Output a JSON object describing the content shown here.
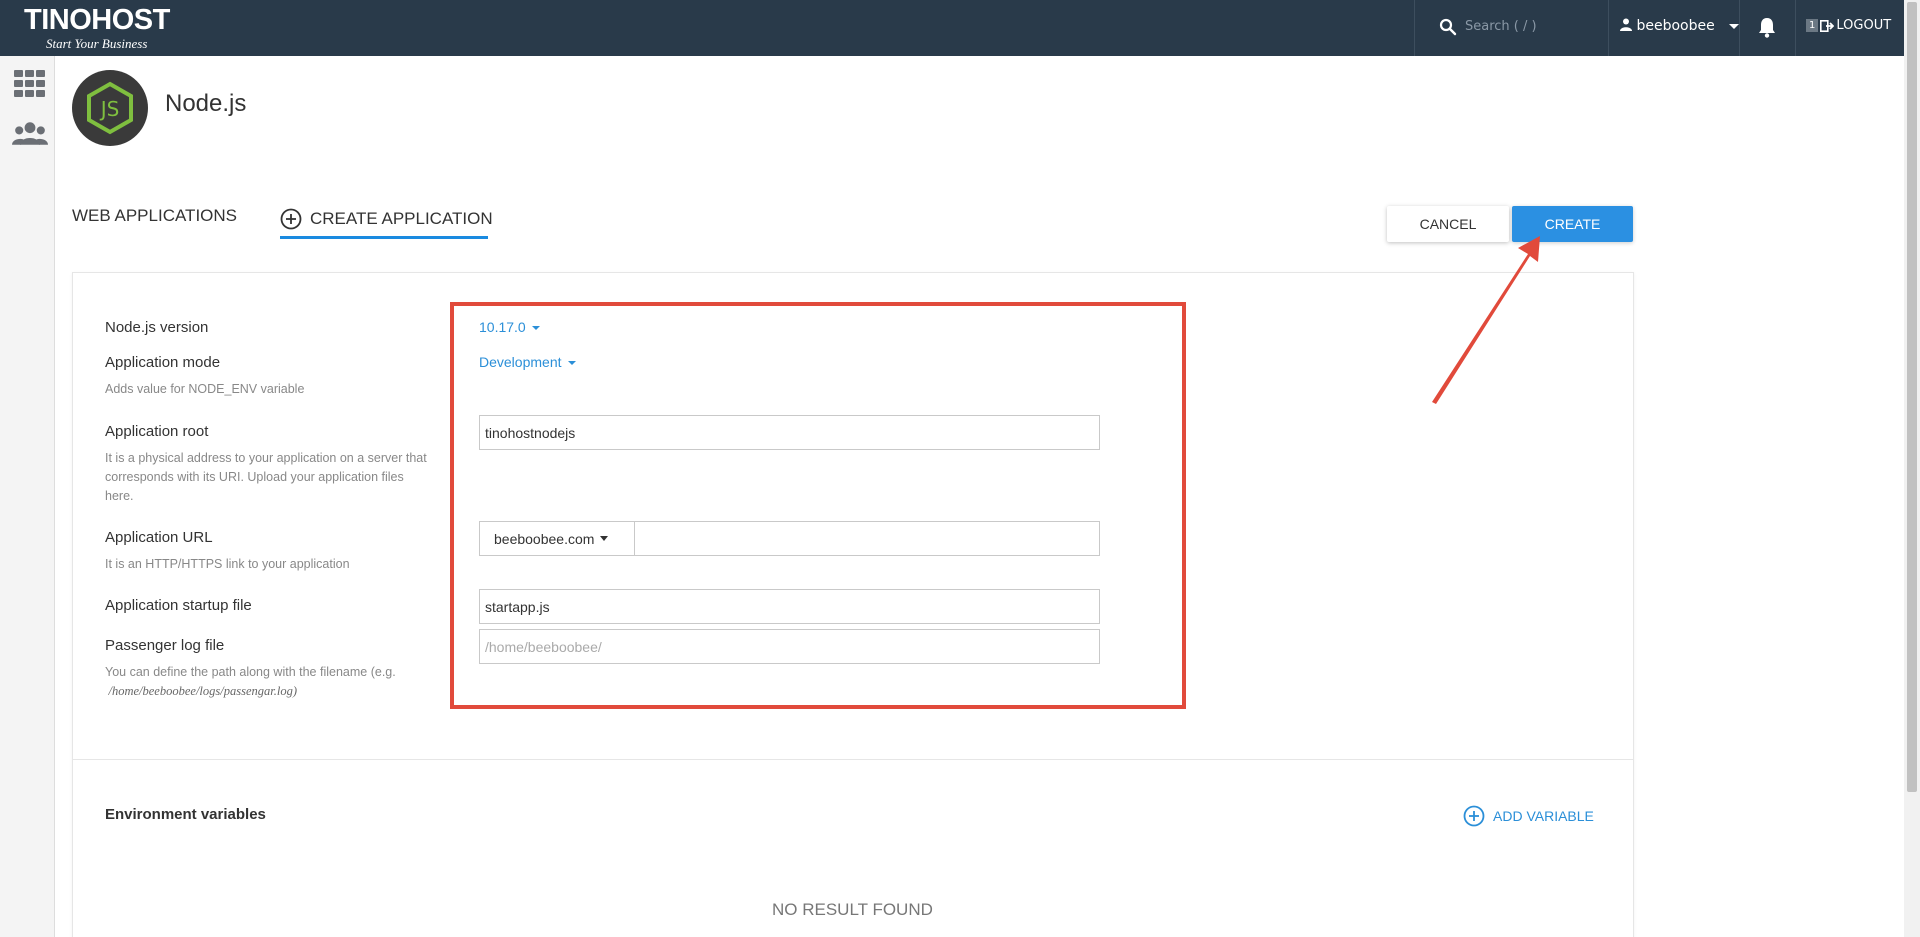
{
  "topbar": {
    "logo_text": "TINOHOST",
    "logo_tagline": "Start Your Business",
    "search_placeholder": "Search ( / )",
    "user_name": "beeboobee",
    "logout_badge": "1",
    "logout_label": "LOGOUT",
    "background_color": "#293a4a"
  },
  "sidebar": {
    "items": [
      {
        "icon": "grid-icon"
      },
      {
        "icon": "users-icon"
      }
    ]
  },
  "page": {
    "title": "Node.js",
    "logo_icon": "nodejs-logo"
  },
  "tabs": [
    {
      "label": "WEB APPLICATIONS",
      "active": false
    },
    {
      "label": "CREATE APPLICATION",
      "active": true
    }
  ],
  "actions": {
    "cancel_label": "CANCEL",
    "create_label": "CREATE",
    "accent_color": "#2b90e2"
  },
  "form": {
    "nodejs_version": {
      "label": "Node.js version",
      "value": "10.17.0"
    },
    "application_mode": {
      "label": "Application mode",
      "hint": "Adds value for NODE_ENV variable",
      "value": "Development"
    },
    "application_root": {
      "label": "Application root",
      "hint": "It is a physical address to your application on a server that corresponds with its URI. Upload your application files here.",
      "value": "tinohostnodejs"
    },
    "application_url": {
      "label": "Application URL",
      "hint": "It is an HTTP/HTTPS link to your application",
      "domain": "beeboobee.com",
      "path": ""
    },
    "startup_file": {
      "label": "Application startup file",
      "value": "startapp.js"
    },
    "passenger_log": {
      "label": "Passenger log file",
      "hint_prefix": "You can define the path along with the filename (e.g.",
      "hint_example": "/home/beeboobee/logs/passengar.log)",
      "placeholder": "/home/beeboobee/"
    }
  },
  "env": {
    "title": "Environment variables",
    "add_label": "ADD VARIABLE",
    "empty_text": "NO RESULT FOUND"
  },
  "annotation_color": "#e14a3b"
}
